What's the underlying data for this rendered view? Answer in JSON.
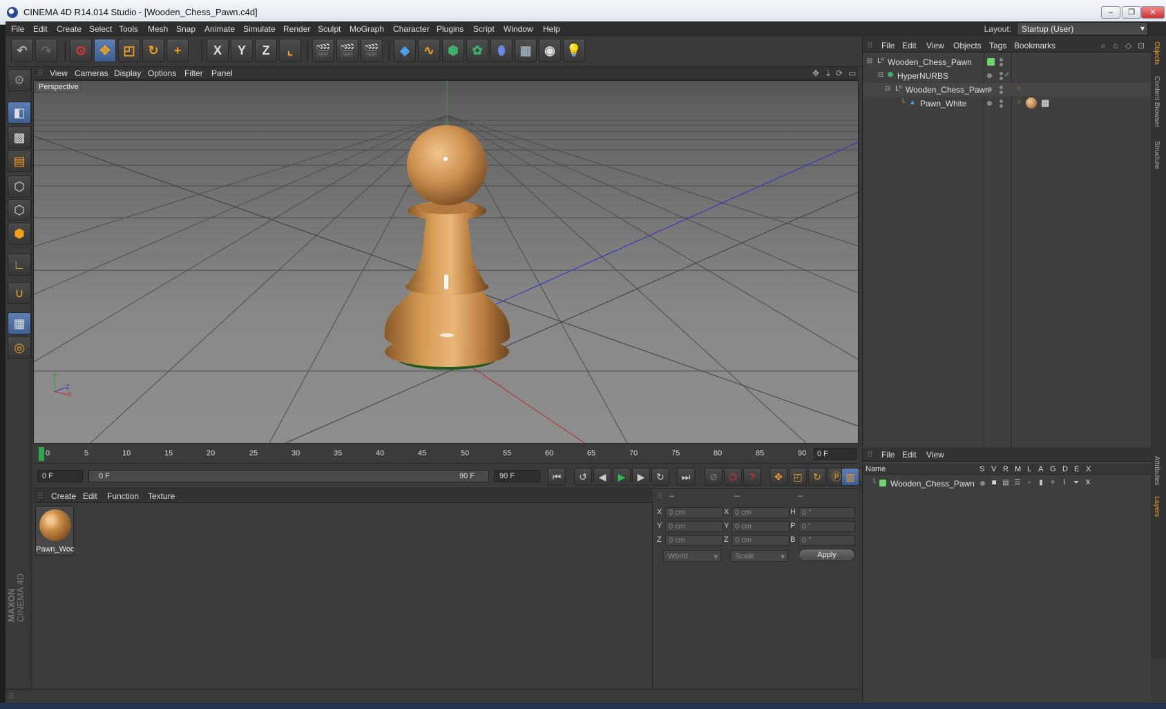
{
  "window": {
    "title": "CINEMA 4D R14.014 Studio - [Wooden_Chess_Pawn.c4d]",
    "minimize": "–",
    "maximize": "❐",
    "close": "✕"
  },
  "menubar": {
    "items": [
      "File",
      "Edit",
      "Create",
      "Select",
      "Tools",
      "Mesh",
      "Snap",
      "Animate",
      "Simulate",
      "Render",
      "Sculpt",
      "MoGraph",
      "Character",
      "Plugins",
      "Script",
      "Window",
      "Help"
    ],
    "layout_label": "Layout:",
    "layout_value": "Startup (User)"
  },
  "toolbar": {
    "x_label": "X",
    "y_label": "Y",
    "z_label": "Z"
  },
  "viewport": {
    "menu": [
      "View",
      "Cameras",
      "Display",
      "Options",
      "Filter",
      "Panel"
    ],
    "camera_label": "Perspective",
    "axis_y": "Y",
    "axis_z": "Z",
    "axis_x": "X"
  },
  "timeline": {
    "ticks": [
      "0",
      "5",
      "10",
      "15",
      "20",
      "25",
      "30",
      "35",
      "40",
      "45",
      "50",
      "55",
      "60",
      "65",
      "70",
      "75",
      "80",
      "85",
      "90"
    ],
    "current_frame": "0 F"
  },
  "transport": {
    "start_field": "0 F",
    "range_start": "0 F",
    "range_end": "90 F",
    "end_field": "90 F"
  },
  "materials": {
    "menu": [
      "Create",
      "Edit",
      "Function",
      "Texture"
    ],
    "items": [
      {
        "name": "Pawn_Woc"
      }
    ]
  },
  "coordinates": {
    "header": [
      "--",
      "--",
      "--"
    ],
    "rows": [
      {
        "a_label": "X",
        "a_value": "0 cm",
        "b_label": "X",
        "b_value": "0 cm",
        "c_label": "H",
        "c_value": "0 °"
      },
      {
        "a_label": "Y",
        "a_value": "0 cm",
        "b_label": "Y",
        "b_value": "0 cm",
        "c_label": "P",
        "c_value": "0 °"
      },
      {
        "a_label": "Z",
        "a_value": "0 cm",
        "b_label": "Z",
        "b_value": "0 cm",
        "c_label": "B",
        "c_value": "0 °"
      }
    ],
    "space": "World",
    "mode": "Scale",
    "apply": "Apply"
  },
  "objects": {
    "menu": [
      "File",
      "Edit",
      "View",
      "Objects",
      "Tags",
      "Bookmarks"
    ],
    "items": [
      {
        "name": "Wooden_Chess_Pawn"
      },
      {
        "name": "HyperNURBS"
      },
      {
        "name": "Wooden_Chess_Pawn"
      },
      {
        "name": "Pawn_White"
      }
    ]
  },
  "layers": {
    "menu": [
      "File",
      "Edit",
      "View"
    ],
    "columns": [
      "Name",
      "S",
      "V",
      "R",
      "M",
      "L",
      "A",
      "G",
      "D",
      "E",
      "X"
    ],
    "items": [
      {
        "name": "Wooden_Chess_Pawn",
        "color": "#6fd26f"
      }
    ]
  },
  "side_tabs": [
    "Objects",
    "Content Browser",
    "Structure",
    "Attributes",
    "Layers"
  ],
  "branding": {
    "line1": "MAXON",
    "line2": "CINEMA 4D"
  },
  "colors": {
    "accent": "#5d7fb3",
    "wood": "#c78a45",
    "axis_x": "#c03030",
    "axis_y": "#30c030",
    "axis_z": "#3040c0"
  }
}
